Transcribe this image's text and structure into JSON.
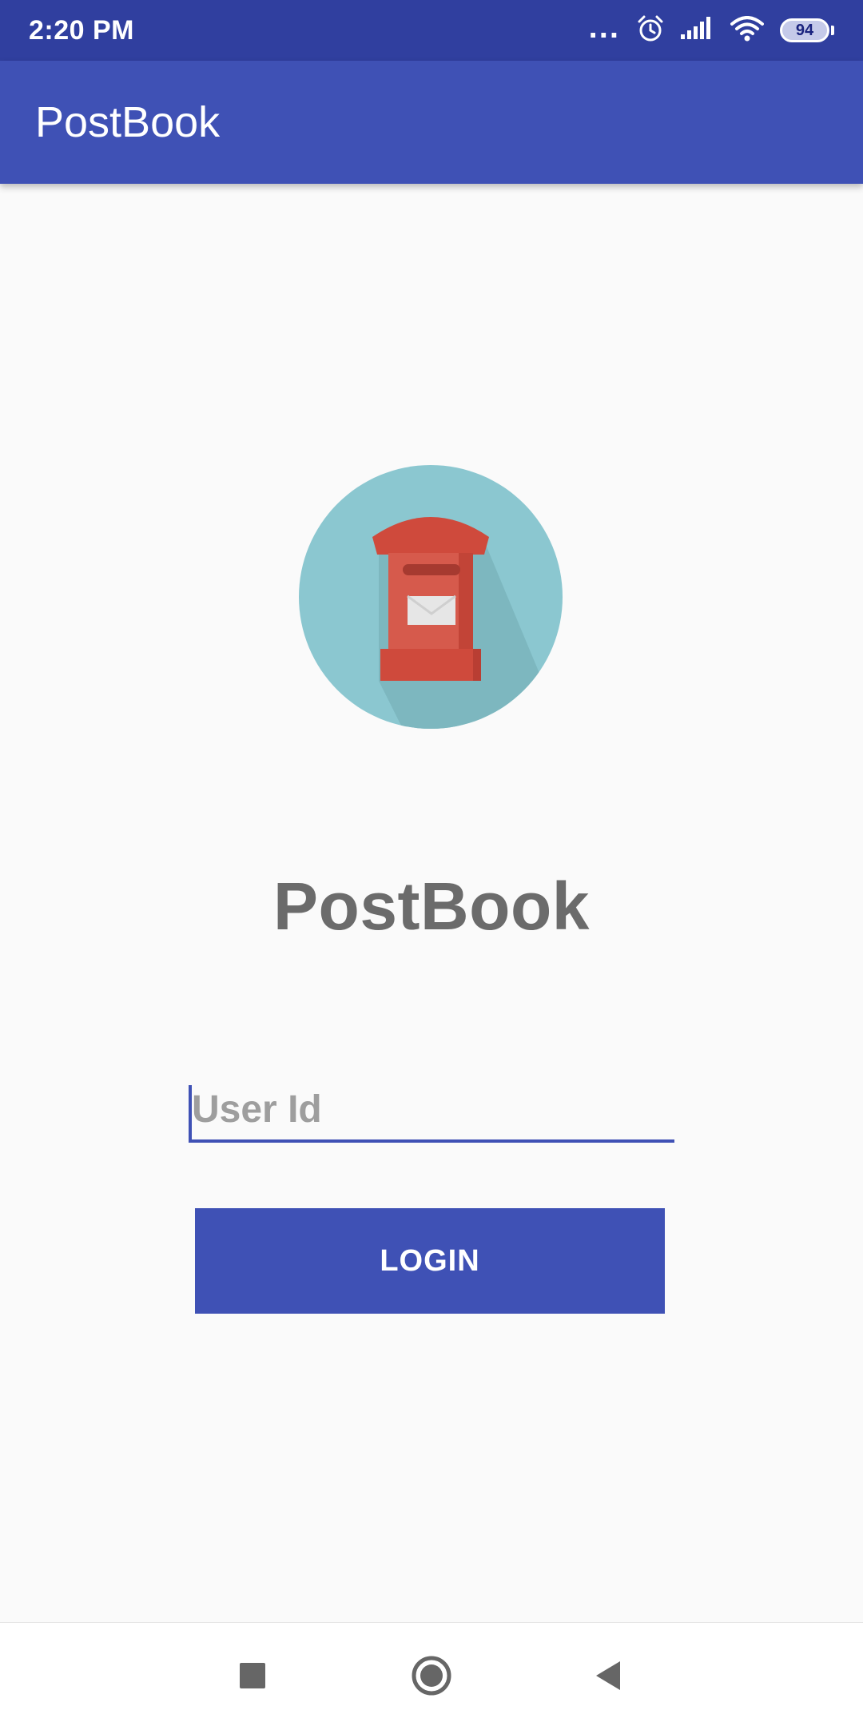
{
  "status_bar": {
    "time": "2:20 PM",
    "dots": "...",
    "battery": "94",
    "icons": [
      "alarm-icon",
      "signal-icon",
      "wifi-icon",
      "battery-icon"
    ]
  },
  "app_bar": {
    "title": "PostBook"
  },
  "main": {
    "logo_icon": "mailbox-icon",
    "brand_title": "PostBook",
    "user_id_input": {
      "placeholder": "User Id",
      "value": ""
    },
    "login_button_label": "LOGIN"
  },
  "nav_bar": {
    "icons": [
      "recents-icon",
      "home-icon",
      "back-icon"
    ]
  },
  "colors": {
    "primary": "#3f51b5",
    "primary_dark": "#303f9f",
    "background": "#fafafa",
    "logo_circle": "#8bc7d0",
    "mailbox_red": "#cf4a3c"
  }
}
